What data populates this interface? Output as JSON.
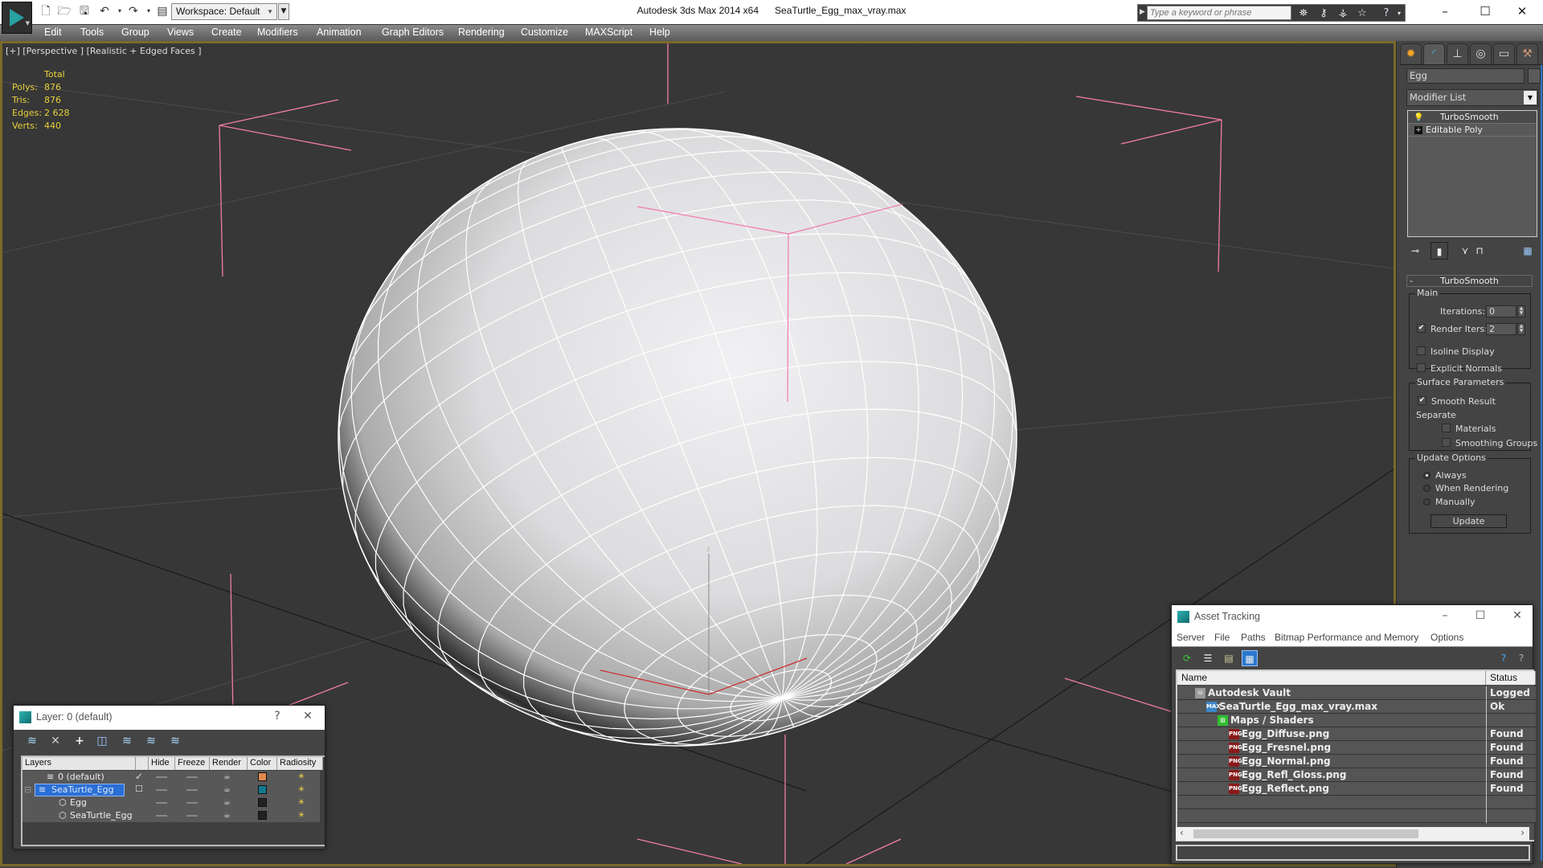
{
  "titlebar": {
    "app_name": "Autodesk 3ds Max  2014 x64",
    "file_name": "SeaTurtle_Egg_max_vray.max",
    "workspace": "Workspace: Default",
    "search_placeholder": "Type a keyword or phrase",
    "quick_access": [
      "new-icon",
      "open-icon",
      "save-icon",
      "undo-icon",
      "redo-icon",
      "project-folder-icon"
    ],
    "window_controls": {
      "minimize": "–",
      "maximize": "☐",
      "close": "✕"
    }
  },
  "menu": [
    "Edit",
    "Tools",
    "Group",
    "Views",
    "Create",
    "Modifiers",
    "Animation",
    "Graph Editors",
    "Rendering",
    "Customize",
    "MAXScript",
    "Help"
  ],
  "viewport": {
    "label": "[+] [Perspective ] [Realistic + Edged Faces ]",
    "stats": {
      "header": "Total",
      "rows": [
        {
          "key": "Polys:",
          "value": "876"
        },
        {
          "key": "Tris:",
          "value": "876"
        },
        {
          "key": "Edges:",
          "value": "2 628"
        },
        {
          "key": "Verts:",
          "value": "440"
        }
      ]
    },
    "gizmo_axis_label": "z",
    "colors": {
      "background": "#373737",
      "selection_bracket": "#f07ca8",
      "border": "#7a6a2c",
      "stats_text": "#e6d23a"
    }
  },
  "command_panel": {
    "tabs": [
      "create-tab",
      "modify-tab",
      "hierarchy-tab",
      "motion-tab",
      "display-tab",
      "utilities-tab"
    ],
    "object_name": "Egg",
    "modifier_list": "Modifier List",
    "stack": [
      {
        "label": "TurboSmooth",
        "icon": "lightbulb-icon",
        "selected": true
      },
      {
        "label": "Editable Poly",
        "icon": "expand-icon",
        "selected": false
      }
    ],
    "rollout": {
      "title": "TurboSmooth",
      "main": {
        "title": "Main",
        "iterations_label": "Iterations:",
        "iterations_value": "0",
        "render_iters_label": "Render Iters:",
        "render_iters_value": "2",
        "render_iters_checked": true,
        "isoline_display": "Isoline Display",
        "isoline_checked": false,
        "explicit_normals": "Explicit Normals",
        "explicit_normals_checked": false
      },
      "surface": {
        "title": "Surface Parameters",
        "smooth_result": "Smooth Result",
        "smooth_result_checked": true,
        "separate": "Separate",
        "materials": "Materials",
        "materials_checked": false,
        "smoothing_groups": "Smoothing Groups",
        "smoothing_groups_checked": false
      },
      "update": {
        "title": "Update Options",
        "options": [
          "Always",
          "When Rendering",
          "Manually"
        ],
        "selected": "Always",
        "button": "Update"
      }
    }
  },
  "layer_dialog": {
    "title": "Layer: 0 (default)",
    "help": "?",
    "close": "✕",
    "columns": [
      "Layers",
      "",
      "Hide",
      "Freeze",
      "Render",
      "Color",
      "Radiosity"
    ],
    "rows": [
      {
        "name": "0 (default)",
        "type": "layer",
        "current": true,
        "selected": false,
        "color": "#e08a4e"
      },
      {
        "name": "SeaTurtle_Egg",
        "type": "layer",
        "current": false,
        "selected": true,
        "color": "#137a8e"
      },
      {
        "name": "Egg",
        "type": "object",
        "current": false,
        "selected": false,
        "color": "#222222"
      },
      {
        "name": "SeaTurtle_Egg",
        "type": "object",
        "current": false,
        "selected": false,
        "color": "#222222"
      }
    ]
  },
  "asset_dialog": {
    "title": "Asset Tracking",
    "menu": [
      "Server",
      "File",
      "Paths",
      "Bitmap Performance and Memory",
      "Options"
    ],
    "columns": [
      "Name",
      "Status"
    ],
    "rows": [
      {
        "name": "Autodesk Vault",
        "status": "Logged Out",
        "icon": "vault-icon",
        "level": 0
      },
      {
        "name": "SeaTurtle_Egg_max_vray.max",
        "status": "Ok",
        "icon": "max-file-icon",
        "level": 1
      },
      {
        "name": "Maps / Shaders",
        "status": "",
        "icon": "maps-icon",
        "level": 2
      },
      {
        "name": "Egg_Diffuse.png",
        "status": "Found",
        "icon": "png-icon",
        "level": 3
      },
      {
        "name": "Egg_Fresnel.png",
        "status": "Found",
        "icon": "png-icon",
        "level": 3
      },
      {
        "name": "Egg_Normal.png",
        "status": "Found",
        "icon": "png-icon",
        "level": 3
      },
      {
        "name": "Egg_Refl_Gloss.png",
        "status": "Found",
        "icon": "png-icon",
        "level": 3
      },
      {
        "name": "Egg_Reflect.png",
        "status": "Found",
        "icon": "png-icon",
        "level": 3
      }
    ]
  }
}
